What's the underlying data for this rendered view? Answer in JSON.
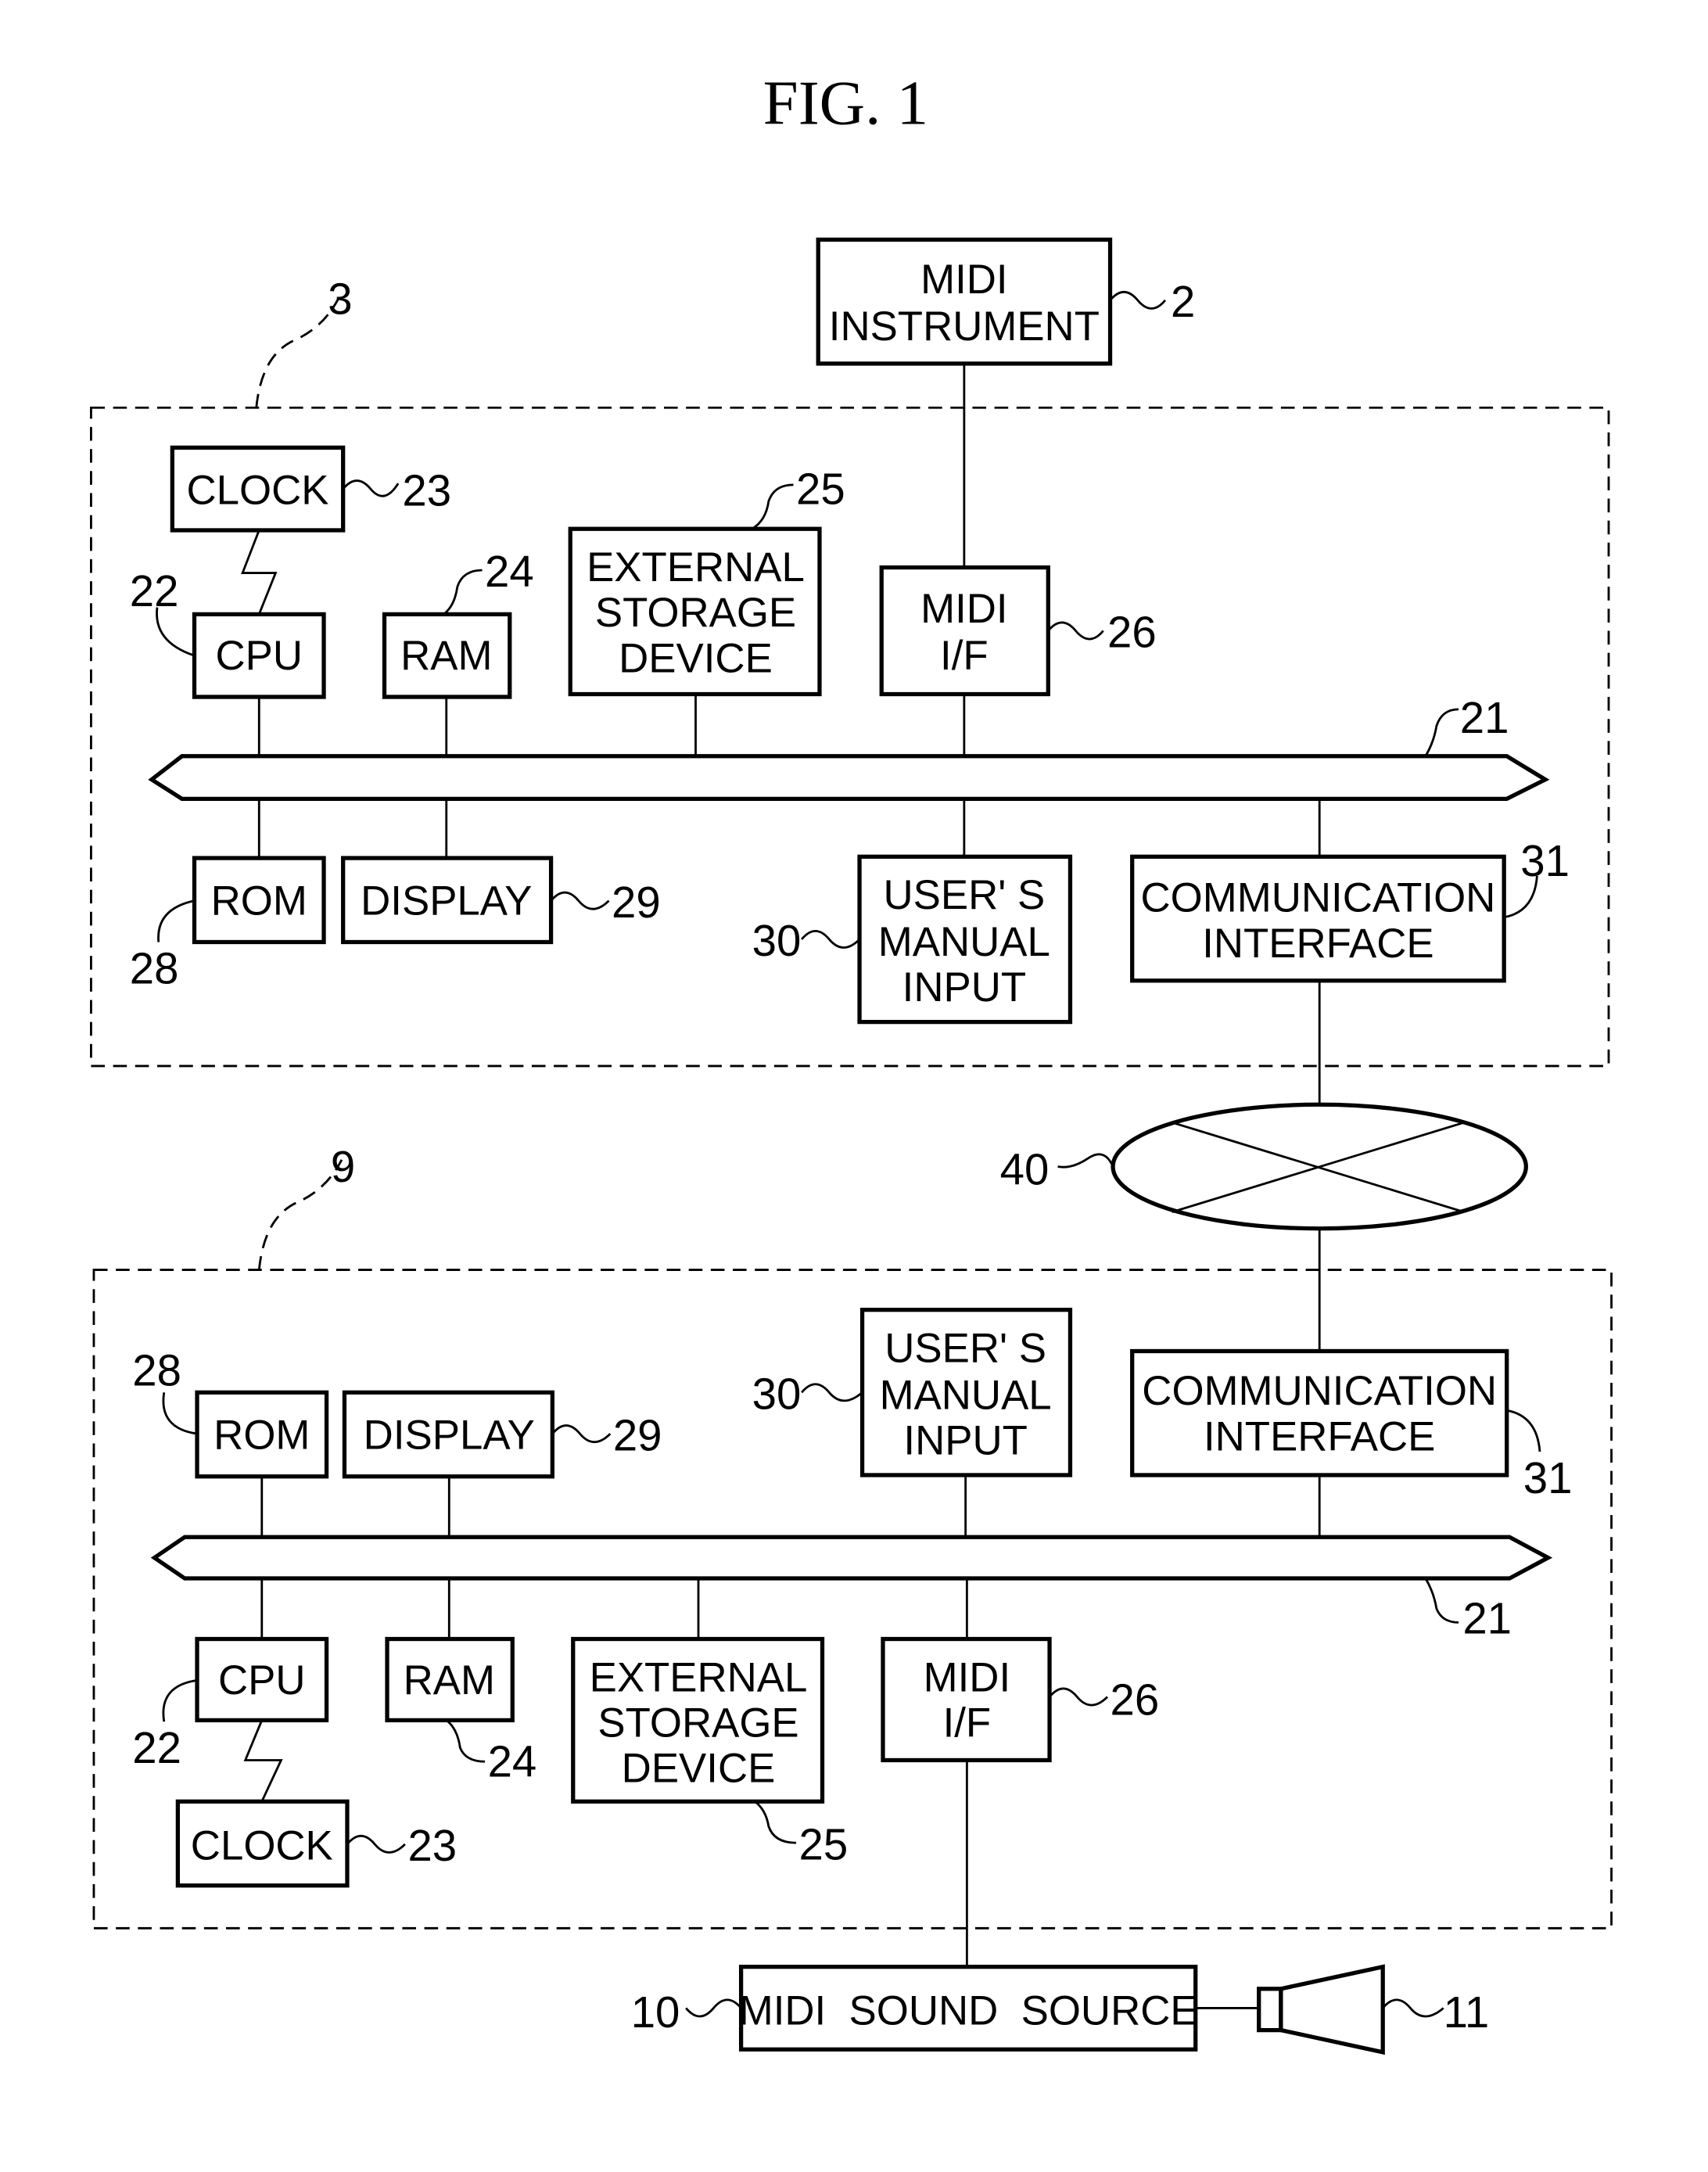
{
  "figure": {
    "title": "FIG. 1"
  },
  "instrument": {
    "lines": [
      "MIDI",
      "INSTRUMENT"
    ],
    "ref": "2"
  },
  "device_top": {
    "ref": "3",
    "clock": {
      "label": "CLOCK",
      "ref": "23"
    },
    "cpu": {
      "label": "CPU",
      "ref": "22"
    },
    "ram": {
      "label": "RAM",
      "ref": "24"
    },
    "storage": {
      "lines": [
        "EXTERNAL",
        "STORAGE",
        "DEVICE"
      ],
      "ref": "25"
    },
    "midi_if": {
      "lines": [
        "MIDI",
        "I/F"
      ],
      "ref": "26"
    },
    "bus": {
      "ref": "21"
    },
    "rom": {
      "label": "ROM",
      "ref": "28"
    },
    "display": {
      "label": "DISPLAY",
      "ref": "29"
    },
    "manual_input": {
      "lines": [
        "USER' S",
        "MANUAL",
        "INPUT"
      ],
      "ref": "30"
    },
    "comm": {
      "lines": [
        "COMMUNICATION",
        "INTERFACE"
      ],
      "ref": "31"
    }
  },
  "network": {
    "ref": "40"
  },
  "device_bottom": {
    "ref": "9",
    "rom": {
      "label": "ROM",
      "ref": "28"
    },
    "display": {
      "label": "DISPLAY",
      "ref": "29"
    },
    "manual_input": {
      "lines": [
        "USER' S",
        "MANUAL",
        "INPUT"
      ],
      "ref": "30"
    },
    "comm": {
      "lines": [
        "COMMUNICATION",
        "INTERFACE"
      ],
      "ref": "31"
    },
    "bus": {
      "ref": "21"
    },
    "cpu": {
      "label": "CPU",
      "ref": "22"
    },
    "ram": {
      "label": "RAM",
      "ref": "24"
    },
    "storage": {
      "lines": [
        "EXTERNAL",
        "STORAGE",
        "DEVICE"
      ],
      "ref": "25"
    },
    "midi_if": {
      "lines": [
        "MIDI",
        "I/F"
      ],
      "ref": "26"
    },
    "clock": {
      "label": "CLOCK",
      "ref": "23"
    }
  },
  "sound_source": {
    "label": "MIDI  SOUND  SOURCE",
    "ref": "10"
  },
  "speaker": {
    "ref": "11"
  }
}
